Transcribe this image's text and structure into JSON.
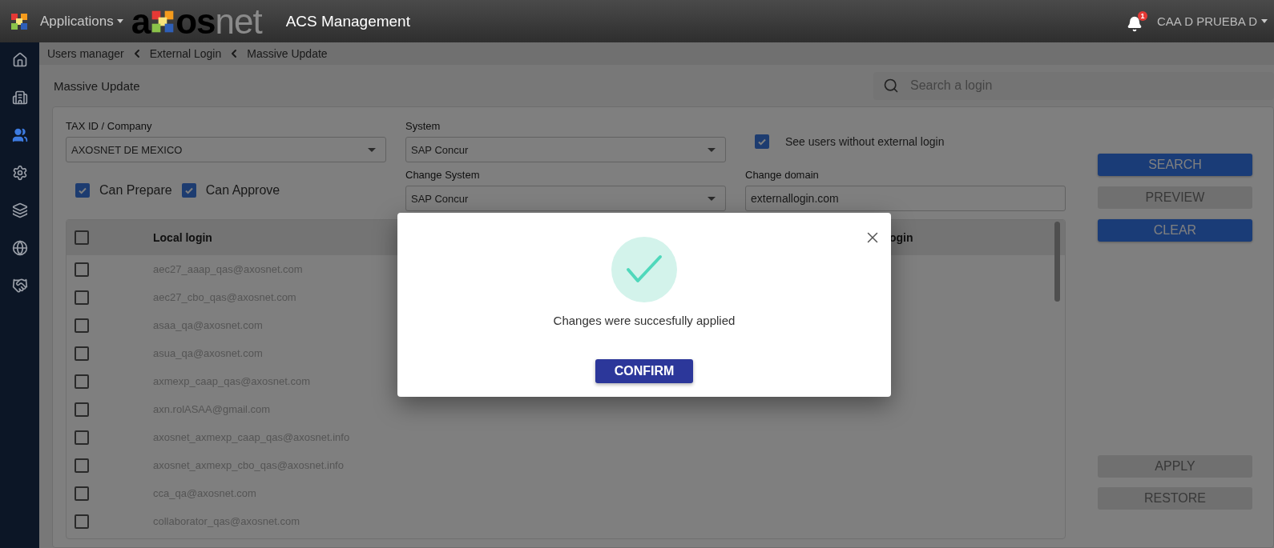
{
  "topbar": {
    "app_menu": "Applications",
    "brand": {
      "lead": "a",
      "middle": "os",
      "tail": "net"
    },
    "title": "ACS Management",
    "notification_count": "1",
    "user": "CAA D PRUEBA D"
  },
  "sidebar": {
    "items": [
      {
        "selected": false
      },
      {
        "selected": false
      },
      {
        "selected": true
      },
      {
        "selected": false
      },
      {
        "selected": false
      },
      {
        "selected": false
      },
      {
        "selected": false
      }
    ]
  },
  "breadcrumb": [
    "Users manager",
    "External Login",
    "Massive Update"
  ],
  "page_title": "Massive Update",
  "search": {
    "placeholder": "Search a login"
  },
  "filters": {
    "tax_id": {
      "label": "TAX ID / Company",
      "value": "AXOSNET DE MEXICO"
    },
    "system": {
      "label": "System",
      "value": "SAP Concur"
    },
    "change_system": {
      "label": "Change System",
      "value": "SAP Concur"
    },
    "change_domain": {
      "label": "Change domain",
      "value": "externallogin.com"
    },
    "see_users_without_login": {
      "label": "See users without external login",
      "checked": true
    },
    "can_prepare": {
      "label": "Can Prepare",
      "checked": true
    },
    "can_approve": {
      "label": "Can Approve",
      "checked": true
    }
  },
  "buttons_top": [
    {
      "label": "SEARCH",
      "disabled": false
    },
    {
      "label": "PREVIEW",
      "disabled": true
    },
    {
      "label": "CLEAR",
      "disabled": false
    }
  ],
  "buttons_bottom": [
    {
      "label": "APPLY",
      "disabled": true
    },
    {
      "label": "RESTORE",
      "disabled": true
    }
  ],
  "table": {
    "select_all_checked": false,
    "columns": [
      "Local login",
      "ogin"
    ],
    "rows": [
      {
        "login": "aec27_aaap_qas@axosnet.com",
        "checked": false
      },
      {
        "login": "aec27_cbo_qas@axosnet.com",
        "checked": false
      },
      {
        "login": "asaa_qa@axosnet.com",
        "checked": false
      },
      {
        "login": "asua_qa@axosnet.com",
        "checked": false
      },
      {
        "login": "axmexp_caap_qas@axosnet.com",
        "checked": false
      },
      {
        "login": "axn.rolASAA@gmail.com",
        "checked": false
      },
      {
        "login": "axosnet_axmexp_caap_qas@axosnet.info",
        "checked": false
      },
      {
        "login": "axosnet_axmexp_cbo_qas@axosnet.info",
        "checked": false
      },
      {
        "login": "cca_qa@axosnet.com",
        "checked": false
      },
      {
        "login": "collaborator_qas@axosnet.com",
        "checked": false
      }
    ]
  },
  "dialog": {
    "message": "Changes were succesfully applied",
    "confirm": "CONFIRM"
  }
}
